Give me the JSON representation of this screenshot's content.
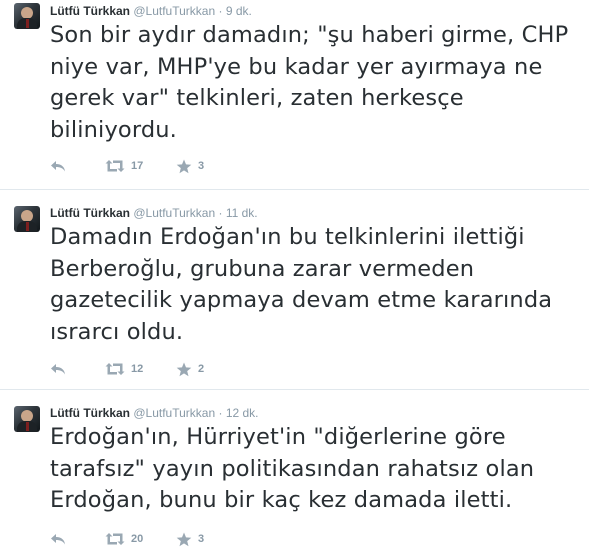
{
  "tweets": [
    {
      "author_name": "Lütfü Türkkan",
      "handle": "@LutfuTurkkan",
      "separator": "·",
      "time": "9 dk.",
      "text": "Son bir aydır damadın; \"şu haberi girme, CHP niye var, MHP'ye bu kadar yer ayırmaya ne gerek var\" telkinleri, zaten herkesçe biliniyordu.",
      "retweets": "17",
      "favorites": "3"
    },
    {
      "author_name": "Lütfü Türkkan",
      "handle": "@LutfuTurkkan",
      "separator": "·",
      "time": "11 dk.",
      "text": "Damadın Erdoğan'ın bu telkinlerini ilettiği Berberoğlu, grubuna zarar vermeden gazetecilik yapmaya devam etme kararında ısrarcı oldu.",
      "retweets": "12",
      "favorites": "2"
    },
    {
      "author_name": "Lütfü Türkkan",
      "handle": "@LutfuTurkkan",
      "separator": "·",
      "time": "12 dk.",
      "text": "Erdoğan'ın, Hürriyet'in \"diğerlerine göre tarafsız\" yayın politikasından rahatsız olan Erdoğan, bunu bir kaç kez damada iletti.",
      "retweets": "20",
      "favorites": "3"
    }
  ],
  "icons": {
    "reply": "reply-icon",
    "retweet": "retweet-icon",
    "favorite": "star-icon"
  },
  "colors": {
    "text": "#292f33",
    "meta": "#8899a6",
    "icon": "#9aa8b3",
    "divider": "#e1e8ed"
  }
}
